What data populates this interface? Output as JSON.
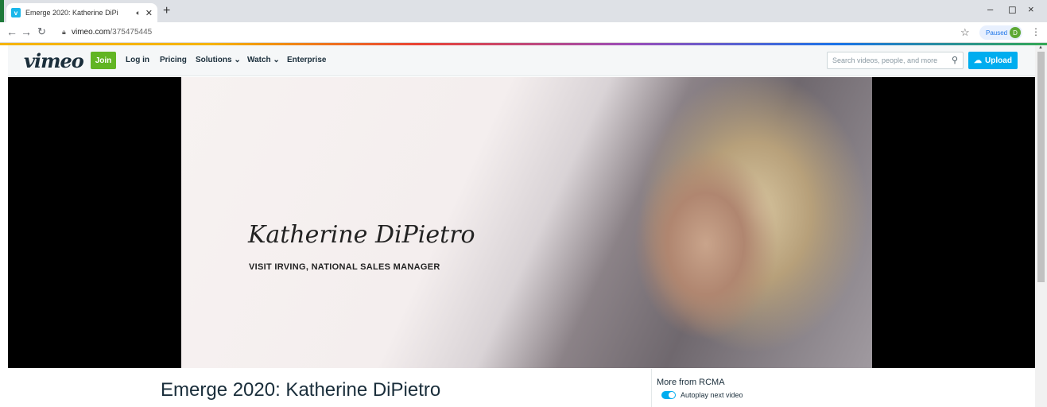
{
  "browser": {
    "tab_title": "Emerge 2020: Katherine DiPi",
    "tab_favicon": "vimeo-icon",
    "new_tab": "+",
    "minimize": "–",
    "restore": "▢",
    "close": "×",
    "url_domain": "vimeo.com",
    "url_path": "/375475445",
    "profile_status": "Paused",
    "profile_initial": "D"
  },
  "vimeo_header": {
    "logo": "vimeo",
    "join": "Join",
    "menu": [
      "Log in",
      "Pricing",
      "Solutions ⌄",
      "Watch ⌄",
      "Enterprise"
    ],
    "search_placeholder": "Search videos, people, and more",
    "upload": "Upload"
  },
  "video": {
    "overlay_name": "Katherine DiPietro",
    "overlay_title": "VISIT IRVING, NATIONAL SALES MANAGER"
  },
  "page": {
    "video_title": "Emerge 2020: Katherine DiPietro",
    "more_from": "More from RCMA",
    "autoplay_label": "Autoplay next video"
  },
  "colors": {
    "join_green": "#61b523",
    "upload_blue": "#00adef",
    "text_dark": "#1a2e3b"
  }
}
